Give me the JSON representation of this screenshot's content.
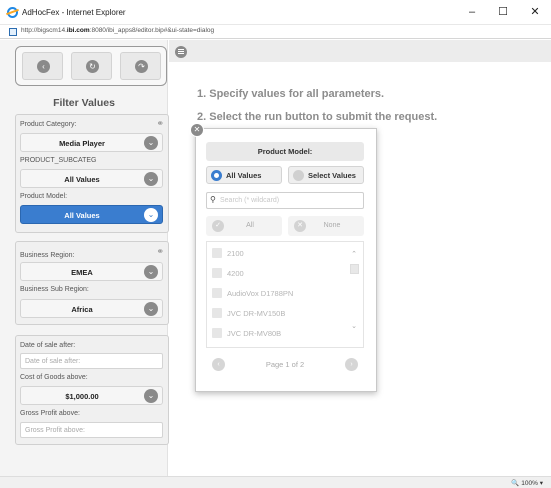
{
  "window": {
    "title": "AdHocFex - Internet Explorer",
    "url_prefix": "http://bigscm14.",
    "url_domain": "ibi.com",
    "url_suffix": ":8080/ibi_apps8/editor.bip#&ui-state=dialog",
    "minimize": "–",
    "maximize": "☐",
    "close": "✕",
    "zoom": "100%"
  },
  "nav": {
    "back_icon": "back-icon",
    "refresh_icon": "refresh-icon",
    "forward_icon": "forward-icon"
  },
  "filter": {
    "title": "Filter Values",
    "product_group": {
      "category_label": "Product Category:",
      "category_value": "Media Player",
      "subcateg_label": "PRODUCT_SUBCATEG",
      "subcateg_value": "All Values",
      "model_label": "Product Model:",
      "model_value": "All Values"
    },
    "region_group": {
      "region_label": "Business Region:",
      "region_value": "EMEA",
      "subregion_label": "Business Sub Region:",
      "subregion_value": "Africa"
    },
    "other_group": {
      "date_label": "Date of sale after:",
      "date_placeholder": "Date of sale after:",
      "cost_label": "Cost of Goods above:",
      "cost_value": "$1,000.00",
      "profit_label": "Gross Profit above:",
      "profit_placeholder": "Gross Profit above:"
    }
  },
  "instructions": {
    "step1": "1. Specify values for all parameters.",
    "step2": "2. Select the run button to submit the request."
  },
  "dialog": {
    "title": "Product Model:",
    "all_values": "All Values",
    "select_values": "Select Values",
    "search_placeholder": "Search (* wildcard)",
    "all_button": "All",
    "none_button": "None",
    "items": [
      "2100",
      "4200",
      "AudioVox D1788PN",
      "JVC DR-MV150B",
      "JVC DR-MV80B"
    ],
    "pager": "Page 1 of 2"
  },
  "colors": {
    "accent": "#3a7dcf",
    "icon_gray": "#8a8a8a"
  }
}
